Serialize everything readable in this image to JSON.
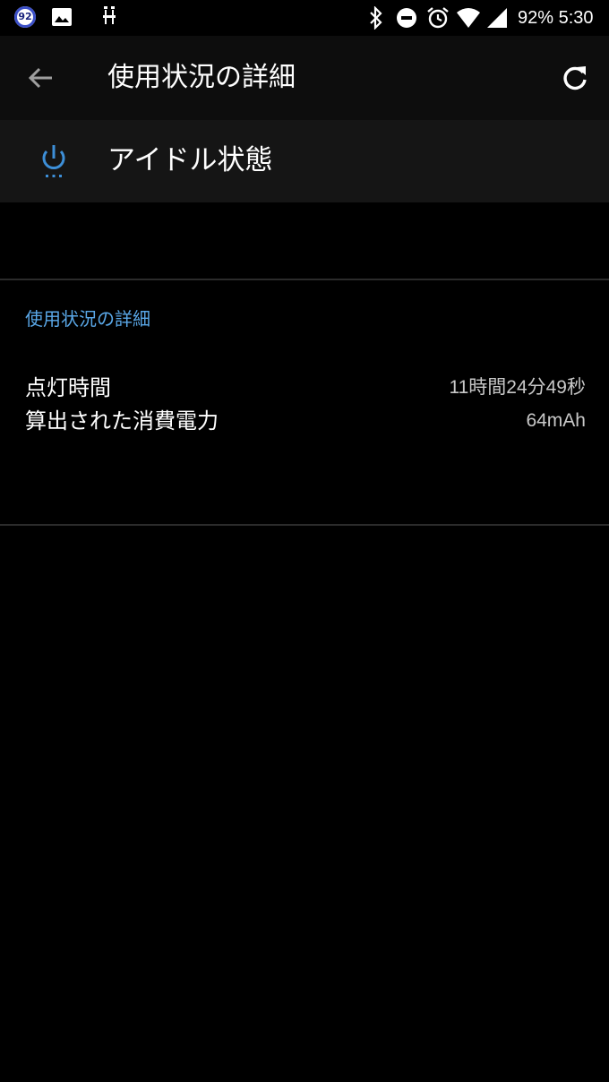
{
  "status_bar": {
    "notification_badge": "92",
    "icons": [
      "image-icon",
      "usb-icon",
      "bluetooth-icon",
      "do-not-disturb-icon",
      "alarm-icon",
      "wifi-icon",
      "signal-icon"
    ],
    "battery_time": "92% 5:30"
  },
  "toolbar": {
    "title": "使用状況の詳細",
    "back_icon": "arrow-left-icon",
    "refresh_icon": "refresh-icon"
  },
  "header": {
    "icon": "power-icon",
    "label": "アイドル状態"
  },
  "details": {
    "section_title": "使用状況の詳細",
    "rows": [
      {
        "label": "点灯時間",
        "value": "11時間24分49秒"
      },
      {
        "label": "算出された消費電力",
        "value": "64mAh"
      }
    ]
  },
  "colors": {
    "accent": "#5aa8e8",
    "background": "#000000",
    "toolbar": "#0d0d0d",
    "header_card": "#151515"
  }
}
